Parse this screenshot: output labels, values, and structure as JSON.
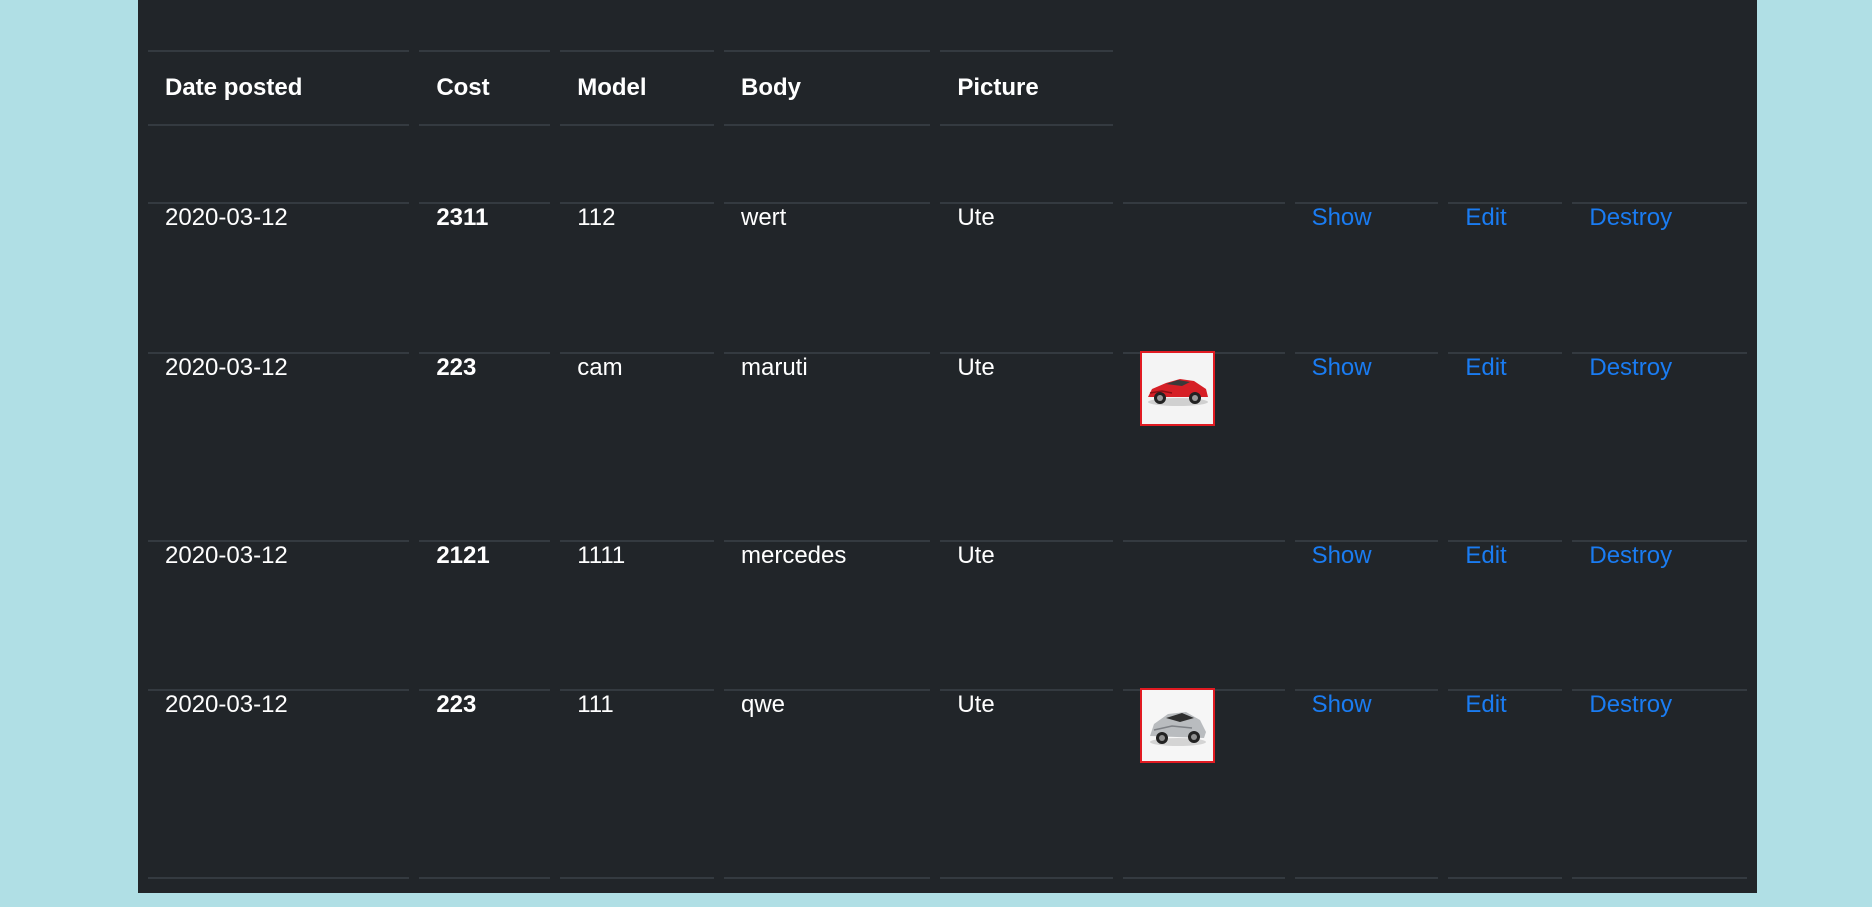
{
  "table": {
    "headers": [
      "Date posted",
      "Cost",
      "Model",
      "Body",
      "Picture"
    ],
    "rows": [
      {
        "date": "2020-03-12",
        "cost": "2311",
        "model": "112",
        "body": "wert",
        "picture": "Ute",
        "image": "",
        "show": "Show",
        "edit": "Edit",
        "destroy": "Destroy"
      },
      {
        "date": "2020-03-12",
        "cost": "223",
        "model": "cam",
        "body": "maruti",
        "picture": "Ute",
        "image": "red-sports-car-thumbnail",
        "show": "Show",
        "edit": "Edit",
        "destroy": "Destroy"
      },
      {
        "date": "2020-03-12",
        "cost": "2121",
        "model": "1111",
        "body": "mercedes",
        "picture": "Ute",
        "image": "",
        "show": "Show",
        "edit": "Edit",
        "destroy": "Destroy"
      },
      {
        "date": "2020-03-12",
        "cost": "223",
        "model": "111",
        "body": "qwe",
        "picture": "Ute",
        "image": "silver-sports-car-thumbnail",
        "show": "Show",
        "edit": "Edit",
        "destroy": "Destroy"
      }
    ]
  },
  "colors": {
    "page_background": "#b0dfe5",
    "panel_background": "#212529",
    "link": "#1a7cf2",
    "thumbnail_border": "#e11b22"
  }
}
